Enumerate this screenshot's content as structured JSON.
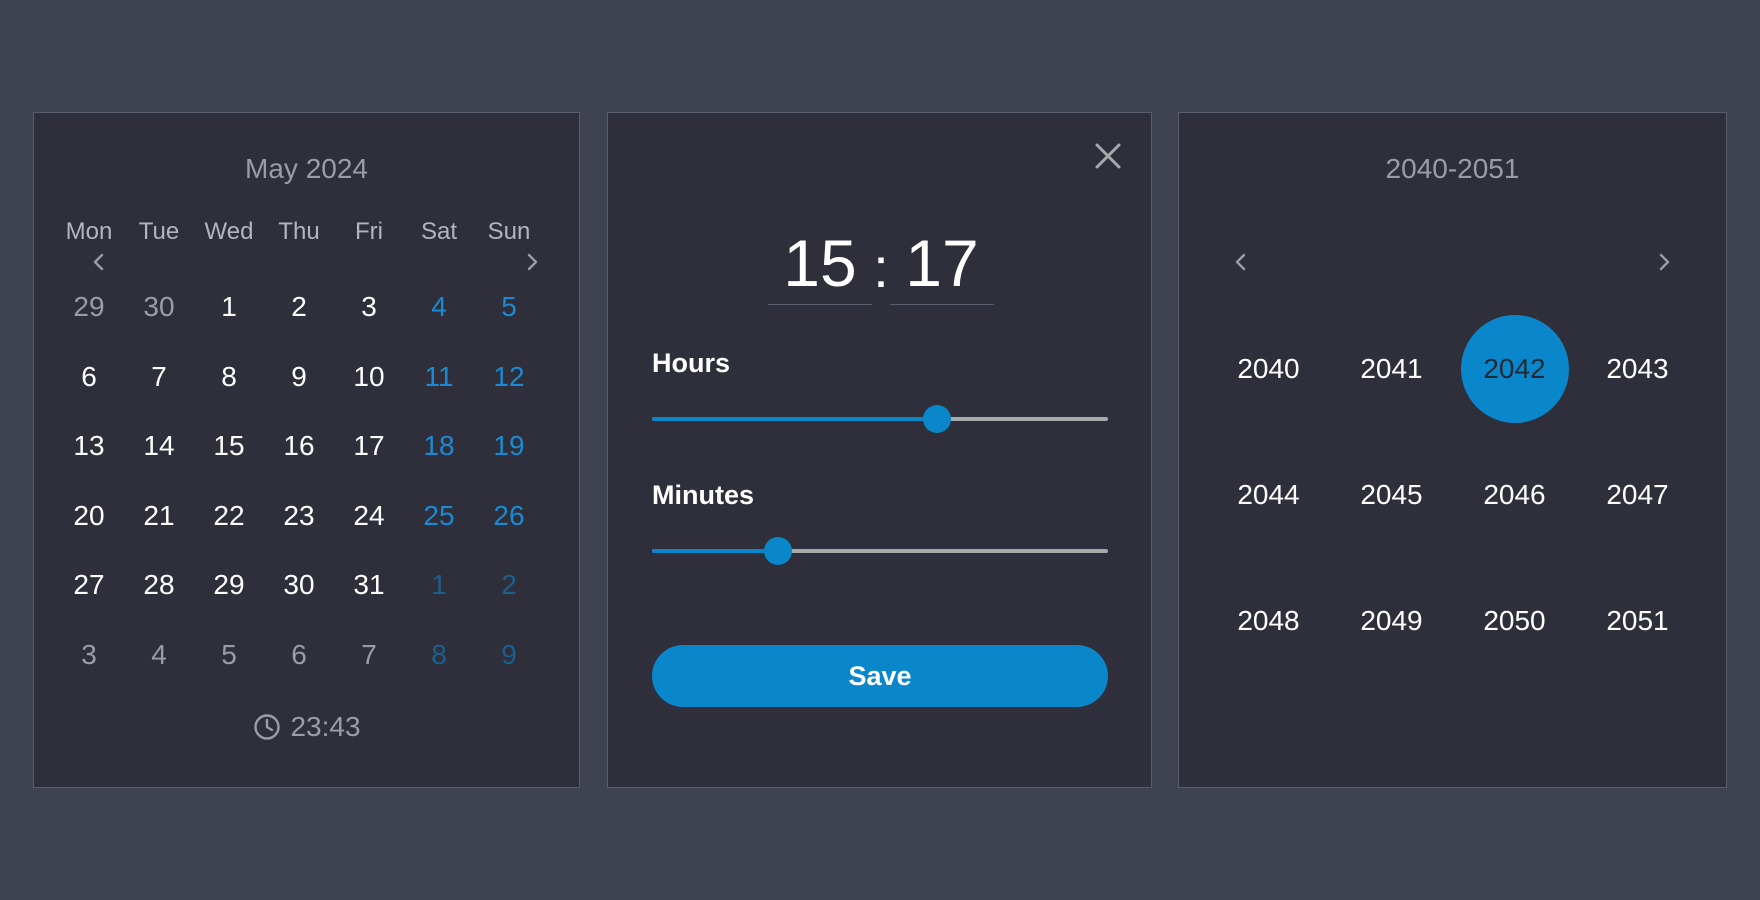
{
  "calendar": {
    "month_title": "May 2024",
    "weekdays": [
      "Mon",
      "Tue",
      "Wed",
      "Thu",
      "Fri",
      "Sat",
      "Sun"
    ],
    "weeks": [
      [
        {
          "d": "29",
          "m": "other"
        },
        {
          "d": "30",
          "m": "other"
        },
        {
          "d": "1",
          "m": "cur"
        },
        {
          "d": "2",
          "m": "cur"
        },
        {
          "d": "3",
          "m": "cur"
        },
        {
          "d": "4",
          "m": "cur"
        },
        {
          "d": "5",
          "m": "cur"
        }
      ],
      [
        {
          "d": "6",
          "m": "cur"
        },
        {
          "d": "7",
          "m": "cur"
        },
        {
          "d": "8",
          "m": "cur"
        },
        {
          "d": "9",
          "m": "cur"
        },
        {
          "d": "10",
          "m": "cur"
        },
        {
          "d": "11",
          "m": "cur"
        },
        {
          "d": "12",
          "m": "cur"
        }
      ],
      [
        {
          "d": "13",
          "m": "cur"
        },
        {
          "d": "14",
          "m": "cur"
        },
        {
          "d": "15",
          "m": "cur"
        },
        {
          "d": "16",
          "m": "cur"
        },
        {
          "d": "17",
          "m": "cur"
        },
        {
          "d": "18",
          "m": "cur"
        },
        {
          "d": "19",
          "m": "cur"
        }
      ],
      [
        {
          "d": "20",
          "m": "cur"
        },
        {
          "d": "21",
          "m": "cur"
        },
        {
          "d": "22",
          "m": "cur"
        },
        {
          "d": "23",
          "m": "cur"
        },
        {
          "d": "24",
          "m": "cur"
        },
        {
          "d": "25",
          "m": "cur"
        },
        {
          "d": "26",
          "m": "cur"
        }
      ],
      [
        {
          "d": "27",
          "m": "cur"
        },
        {
          "d": "28",
          "m": "cur"
        },
        {
          "d": "29",
          "m": "cur"
        },
        {
          "d": "30",
          "m": "cur"
        },
        {
          "d": "31",
          "m": "cur"
        },
        {
          "d": "1",
          "m": "other"
        },
        {
          "d": "2",
          "m": "other"
        }
      ],
      [
        {
          "d": "3",
          "m": "other"
        },
        {
          "d": "4",
          "m": "other"
        },
        {
          "d": "5",
          "m": "other"
        },
        {
          "d": "6",
          "m": "other"
        },
        {
          "d": "7",
          "m": "other"
        },
        {
          "d": "8",
          "m": "other"
        },
        {
          "d": "9",
          "m": "other"
        }
      ]
    ],
    "clock_time": "23:43",
    "icons": {
      "prev": "chevron-left-icon",
      "next": "chevron-right-icon",
      "clock": "clock-icon"
    }
  },
  "time_picker": {
    "hours": "15",
    "separator": ":",
    "minutes": "17",
    "hours_label": "Hours",
    "minutes_label": "Minutes",
    "hours_value": 15,
    "hours_max": 23,
    "minutes_value": 17,
    "minutes_max": 59,
    "save_label": "Save",
    "icons": {
      "close": "close-icon"
    }
  },
  "year_picker": {
    "range_title": "2040-2051",
    "years": [
      "2040",
      "2041",
      "2042",
      "2043",
      "2044",
      "2045",
      "2046",
      "2047",
      "2048",
      "2049",
      "2050",
      "2051"
    ],
    "selected": "2042",
    "icons": {
      "prev": "chevron-left-icon",
      "next": "chevron-right-icon"
    }
  },
  "colors": {
    "background": "#3f4250",
    "panel": "#2e2f3a",
    "accent": "#0a87cb",
    "muted_text": "#9a9ca6",
    "weekend": "#1a8ad4"
  }
}
